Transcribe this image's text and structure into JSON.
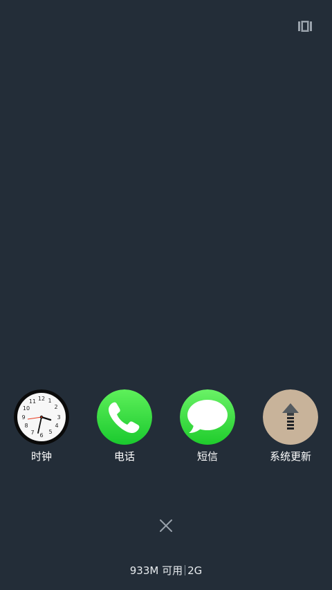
{
  "top_bar": {
    "icon": "multi-window-icon"
  },
  "apps": [
    {
      "label": "时钟",
      "icon": "clock-icon"
    },
    {
      "label": "电话",
      "icon": "phone-icon"
    },
    {
      "label": "短信",
      "icon": "messages-icon"
    },
    {
      "label": "系统更新",
      "icon": "system-update-icon"
    }
  ],
  "clock_face": {
    "numbers": [
      "12",
      "1",
      "2",
      "3",
      "4",
      "5",
      "6",
      "7",
      "8",
      "9",
      "10",
      "11"
    ]
  },
  "close": {
    "icon": "close-icon"
  },
  "memory": {
    "available": "933M 可用",
    "total": "2G"
  },
  "colors": {
    "background": "#232d38",
    "phone_green": "#2fd53a",
    "sms_green": "#3ddc3b",
    "update_beige": "#c8b39a"
  }
}
